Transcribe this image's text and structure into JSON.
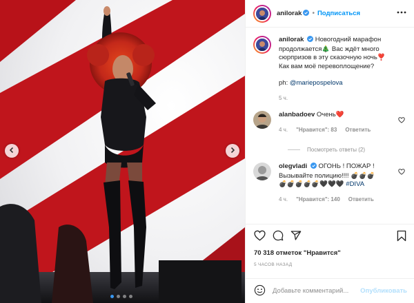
{
  "post": {
    "author": "anilorak",
    "follow_label": "Подписаться",
    "separator": "•",
    "caption_author": "anilorak",
    "caption_lines": [
      "Новогодний марафон",
      "продолжается🎄 Вас ждёт много",
      "сюрпризов в эту сказочную ночь❣️",
      "Как вам моё перевоплощение?"
    ],
    "photo_credit_prefix": "ph: ",
    "photo_credit_handle": "@marieposрelova",
    "caption_time": "5 ч."
  },
  "comments": [
    {
      "user": "alanbadoev",
      "text": "Очень❤️",
      "time": "4 ч.",
      "likes": "\"Нравится\": 83",
      "reply": "Ответить"
    },
    {
      "user": "olegvladi",
      "text_lines": [
        "ОГОНЬ ! ПОЖАР !",
        "Вызывайте полицию!!!! 💣💣💣",
        "💣💣💣💣💣🖤🖤🖤 "
      ],
      "hashtag": "#DIVA",
      "time": "4 ч.",
      "likes": "\"Нравится\": 140",
      "reply": "Ответить"
    }
  ],
  "view_replies": "Посмотреть ответы (2)",
  "likes_count": "70 318 отметок \"Нравится\"",
  "posted_ago": "5 ЧАСОВ НАЗАД",
  "comment_input": {
    "placeholder": "Добавьте комментарий...",
    "value": ""
  },
  "publish_label": "Опубликовать",
  "carousel": {
    "slides": 4,
    "active_slide": 1
  },
  "icons": {
    "prev": "chevron-left-icon",
    "next": "chevron-right-icon",
    "verified": "verified-badge-icon",
    "more": "more-icon",
    "like": "heart-icon",
    "comment": "comment-icon",
    "share": "share-icon",
    "save": "bookmark-icon",
    "emoji": "emoji-icon"
  },
  "colors": {
    "accent": "#0095f6",
    "verified": "#3897f0",
    "muted": "#8e8e8e",
    "publish_disabled": "#b2dffc",
    "stage_red": "#c0151c"
  }
}
